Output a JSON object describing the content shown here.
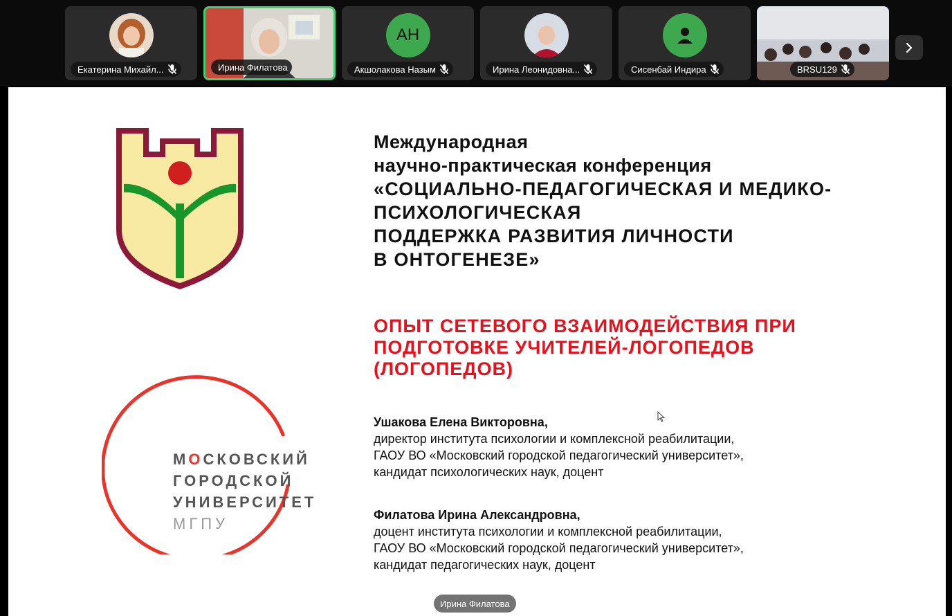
{
  "participants": [
    {
      "name": "Екатерина Михайл...",
      "mic": "muted",
      "avatar": "photo"
    },
    {
      "name": "Ирина Филатова",
      "mic": "on",
      "avatar": "video",
      "active": true
    },
    {
      "name": "Акшолакова Назым",
      "mic": "muted",
      "avatar": "initials",
      "initials": "АН"
    },
    {
      "name": "Ирина Леонидовна...",
      "mic": "muted",
      "avatar": "photo"
    },
    {
      "name": "Сисенбай Индира",
      "mic": "muted",
      "avatar": "icon"
    },
    {
      "name": "BRSU129",
      "mic": "muted",
      "avatar": "video"
    }
  ],
  "strip": {
    "next_icon": "chevron-right-icon",
    "active_color": "#3ecf6e"
  },
  "slide": {
    "title_lines": [
      "Международная",
      "научно-практическая конференция",
      "«СОЦИАЛЬНО-ПЕДАГОГИЧЕСКАЯ И МЕДИКО-",
      "ПСИХОЛОГИЧЕСКАЯ",
      "ПОДДЕРЖКА РАЗВИТИЯ ЛИЧНОСТИ",
      "В ОНТОГЕНЕЗЕ»"
    ],
    "subtitle_lines": [
      "ОПЫТ СЕТЕВОГО ВЗАИМОДЕЙСТВИЯ ПРИ",
      "ПОДГОТОВКЕ УЧИТЕЛЕЙ-ЛОГОПЕДОВ",
      "(ЛОГОПЕДОВ)"
    ],
    "subtitle_color": "#e8101a",
    "authors": [
      {
        "name": "Ушакова Елена Викторовна,",
        "lines": [
          "директор института психологии и комплексной реабилитации,",
          "ГАОУ ВО «Московский городской педагогический университет»,",
          "кандидат психологических наук, доцент"
        ]
      },
      {
        "name": "Филатова Ирина Александровна,",
        "lines": [
          "доцент института психологии и комплексной реабилитации,",
          "ГАОУ ВО «Московский городской педагогический университет»,",
          "кандидат педагогических наук, доцент"
        ]
      }
    ],
    "logo_mgpu": {
      "line1_first": "М",
      "line1_o": "О",
      "line1_rest": "СКОВСКИЙ",
      "line2": "ГОРОДСКОЙ",
      "line3": "УНИВЕРСИТЕТ",
      "abbr": "МГПУ",
      "ring_color": "#e8342a"
    },
    "crest_colors": {
      "outline": "#8b1a3a",
      "fill": "#f8eaa2",
      "stem": "#19962a",
      "dot": "#d11f1f"
    }
  },
  "speaker_label": "Ирина Филатова"
}
